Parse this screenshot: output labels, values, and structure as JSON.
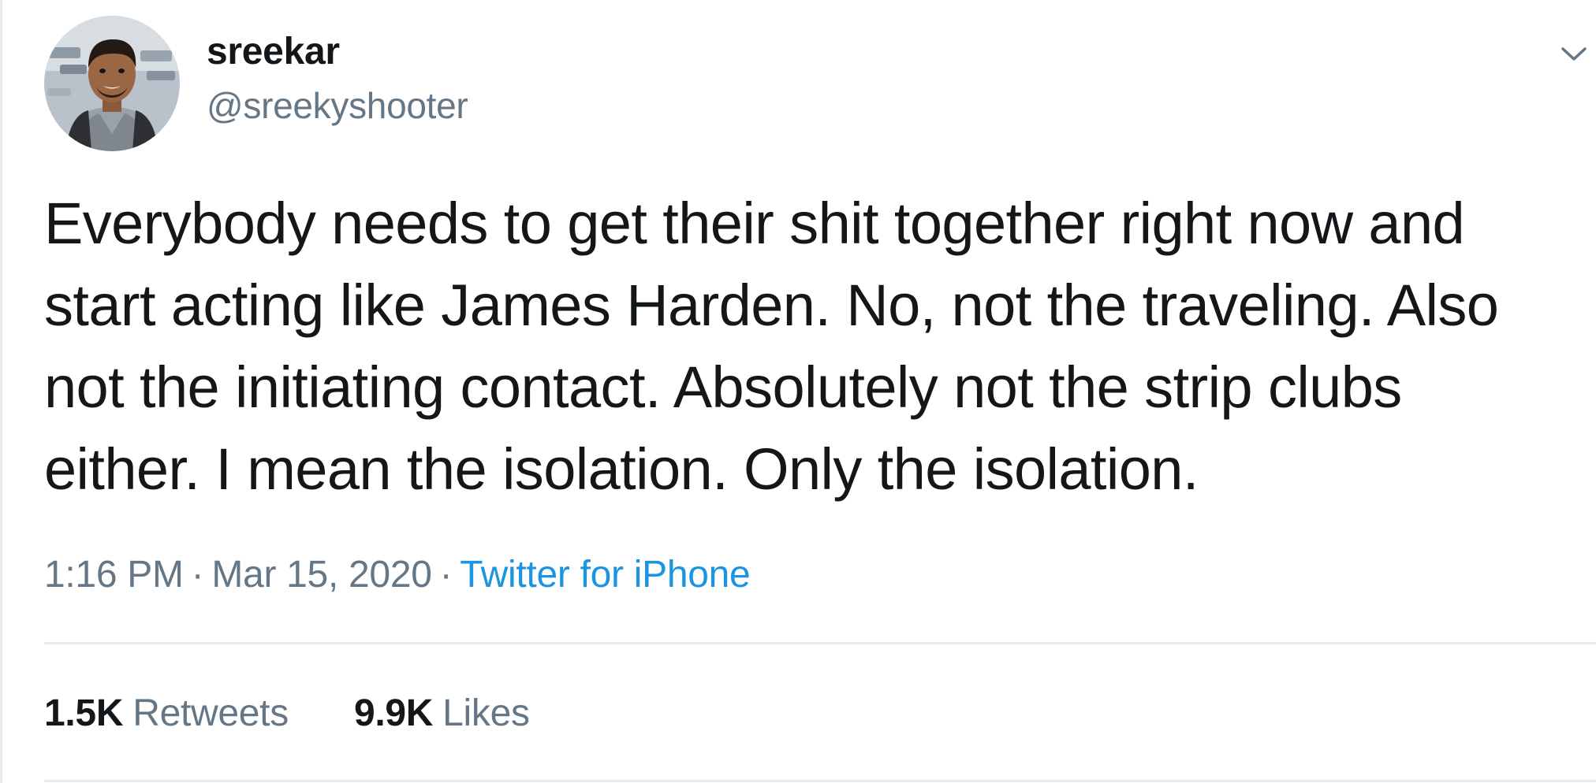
{
  "tweet": {
    "author": {
      "display_name": "sreekar",
      "handle": "@sreekyshooter",
      "avatar_icon": "profile-photo"
    },
    "menu_icon": "chevron-down-icon",
    "text_lines": [
      "Everybody needs to get their shit together right now and",
      "start acting like James Harden. No, not the traveling. Also",
      "not the initiating contact. Absolutely not the strip clubs",
      "either. I mean the isolation. Only the isolation."
    ],
    "time": "1:16 PM",
    "separator": "·",
    "date": "Mar 15, 2020",
    "source": "Twitter for iPhone",
    "stats": {
      "retweets_count": "1.5K",
      "retweets_label": "Retweets",
      "likes_count": "9.9K",
      "likes_label": "Likes"
    }
  },
  "colors": {
    "text": "#14171a",
    "secondary": "#657786",
    "link": "#1b95e0",
    "divider": "#e6ecf0"
  }
}
